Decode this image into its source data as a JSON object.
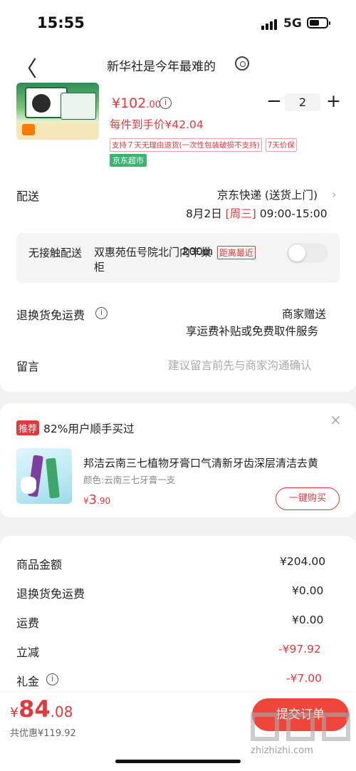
{
  "status_bar": {
    "time": "15:55",
    "network": "5G"
  },
  "nav": {
    "title": "新华社是今年最难的"
  },
  "product": {
    "price_symbol": "¥",
    "price_main": "102",
    "price_decimal": ".00",
    "quantity": "2",
    "unit_price_text": "每件到手价¥42.04",
    "tags": [
      "支持７天无理由退货(一次性包装破损不支持)",
      "7天价保"
    ],
    "store_tag": "京东超市"
  },
  "delivery": {
    "label": "配送",
    "method": "京东快递 (送货上门)",
    "date": "8月2日",
    "weekday": "[周三]",
    "time_range": "09:00-15:00"
  },
  "no_contact": {
    "label": "无接触配送",
    "location": "双惠苑伍号院北门内丰巢柜",
    "distance": "200m",
    "nearest_tag": "距离最近"
  },
  "return_shipping": {
    "label": "退换货免运费",
    "line1": "商家赠送",
    "line2": "享运费补贴或免费取件服务"
  },
  "message": {
    "label": "留言",
    "placeholder": "建议留言前先与商家沟通确认"
  },
  "recommend": {
    "badge": "推荐",
    "title": "82%用户顺手买过",
    "name": "邦洁云南三七植物牙膏口气清新牙齿深层清洁去黄",
    "color": "颜色:云南三七牙膏一支",
    "price_symbol": "¥",
    "price_main": "3",
    "price_decimal": ".90",
    "button": "一键购买"
  },
  "summary": [
    {
      "label": "商品金额",
      "value": "¥204.00"
    },
    {
      "label": "退换货免运费",
      "value": "¥0.00"
    },
    {
      "label": "运费",
      "value": "¥0.00"
    },
    {
      "label": "立减",
      "value": "-¥97.92"
    },
    {
      "label": "礼金",
      "value": "-¥7.00"
    }
  ],
  "footer": {
    "currency": "¥",
    "total_main": "84",
    "total_decimal": ".08",
    "saved": "共优惠¥119.92",
    "submit": "提交订单",
    "watermark": "zhizhizhi.com"
  },
  "colors": {
    "accent": "#e4393c",
    "store_green": "#3cb371"
  },
  "icons": [
    "back-arrow-icon",
    "chat-icon",
    "info-icon",
    "chevron-right-icon",
    "close-icon"
  ]
}
